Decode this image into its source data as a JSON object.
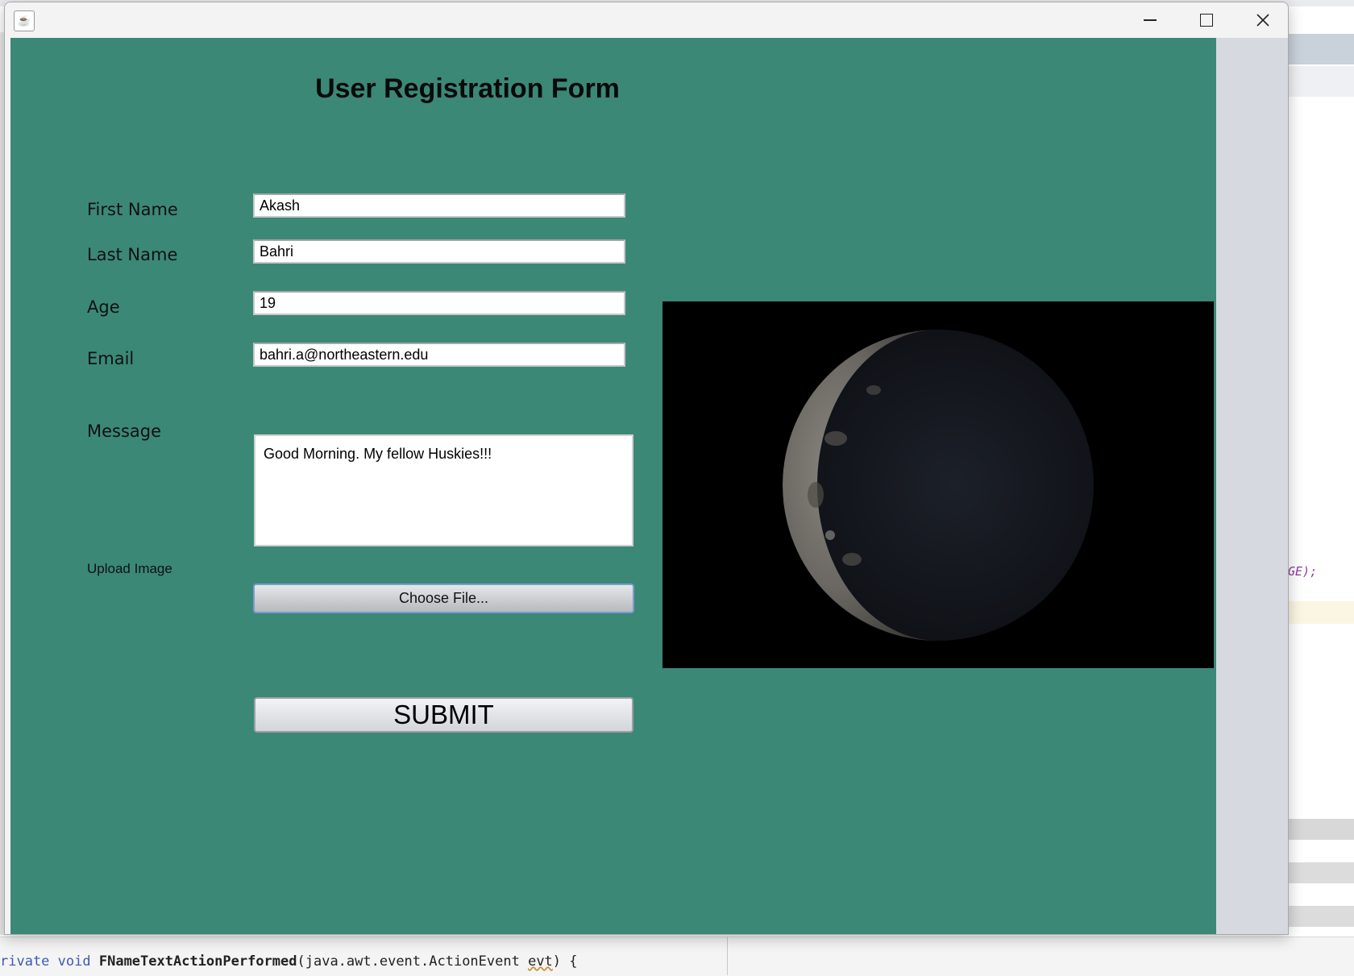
{
  "window": {
    "icon": "java-cup-icon",
    "controls": [
      "minimize-icon",
      "maximize-icon",
      "close-icon"
    ]
  },
  "form": {
    "title": "User Registration Form",
    "background": "#3b8877",
    "fields": {
      "first_name": {
        "label": "First Name",
        "value": "Akash"
      },
      "last_name": {
        "label": "Last Name",
        "value": "Bahri"
      },
      "age": {
        "label": "Age",
        "value": "19"
      },
      "email": {
        "label": "Email",
        "value": "bahri.a@northeastern.edu"
      },
      "message": {
        "label": "Message",
        "value": "Good Morning. My fellow Huskies!!!"
      }
    },
    "upload": {
      "label": "Upload Image",
      "button": "Choose File..."
    },
    "submit": {
      "label": "SUBMIT"
    },
    "image_preview": {
      "subject": "crescent-moon-image"
    }
  },
  "background_ide": {
    "right_code": "GE);",
    "bottom_code": {
      "prefix": "rivate ",
      "kw1": "void",
      "fn": "FNameTextActionPerformed",
      "args_a": "(java.awt.event.ActionEvent ",
      "evt": "evt",
      "args_b": ") {"
    }
  }
}
